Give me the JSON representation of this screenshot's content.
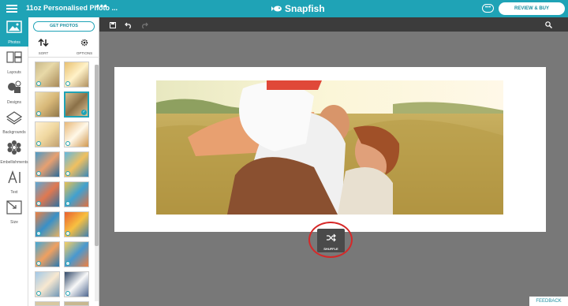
{
  "header": {
    "title": "11oz Personalised Photo ...",
    "more": "•••",
    "logo": "Snapfish",
    "chat": "•••",
    "review_buy": "REVIEW & BUY"
  },
  "rail": {
    "items": [
      {
        "label": "Photos"
      },
      {
        "label": "Layouts"
      },
      {
        "label": "Designs"
      },
      {
        "label": "Backgrounds"
      },
      {
        "label": "Embellishments"
      },
      {
        "label": "Text"
      },
      {
        "label": "Size"
      }
    ]
  },
  "panel": {
    "get_photos": "GET PHOTOS",
    "sort": "SORT",
    "options": "OPTIONS"
  },
  "toolbar": {
    "save": "SAVE",
    "undo": "UNDO",
    "redo": "REDO",
    "zoom": "ZOOM"
  },
  "canvas": {
    "shuffle": "SHUFFLE"
  },
  "feedback": "FEEDBACK",
  "colors": {
    "brand": "#1fa3b6",
    "canvas_bg": "#787878",
    "toolbar": "#3c3c3c",
    "highlight_circle": "#d62828"
  }
}
